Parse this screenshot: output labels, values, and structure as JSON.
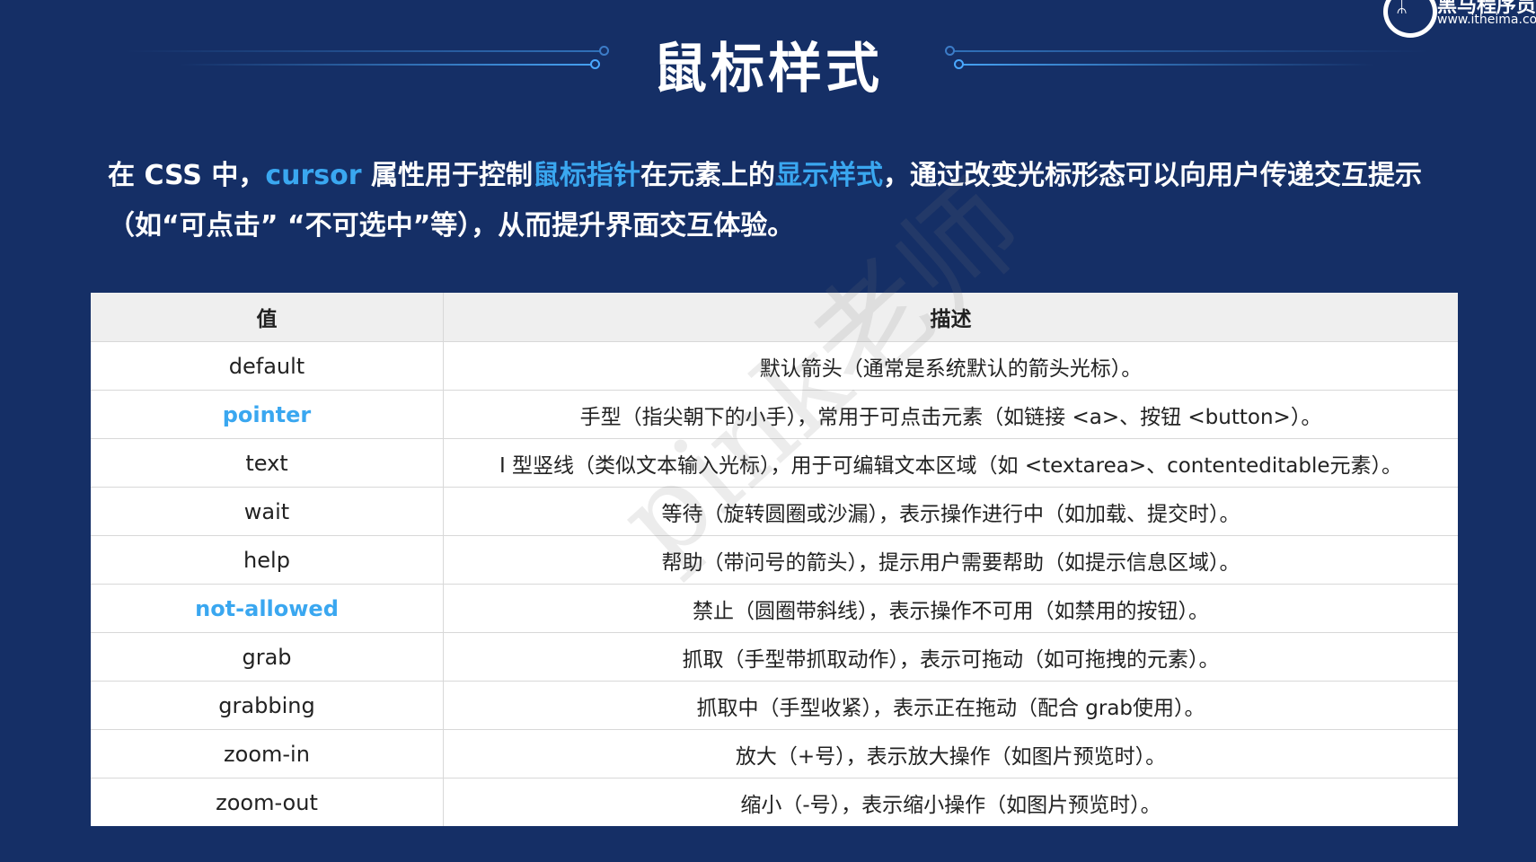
{
  "slide": {
    "title": "鼠标样式",
    "logo": {
      "name": "黑马程序员",
      "url": "www.itheima.com"
    },
    "intro": {
      "p1": "在 CSS 中，",
      "h1": "cursor",
      "p2": " 属性用于控制",
      "h2": "鼠标指针",
      "p3": "在元素上的",
      "h3": "显示样式",
      "p4": "，通过改变光标形态可以向用户传递交互提示（如“可点击” “不可选中”等），从而提升界面交互体验。"
    },
    "watermark": "pink老师",
    "colors": {
      "background": "#152f66",
      "highlight": "#3aa7f0",
      "table_header": "#efefef"
    }
  },
  "table": {
    "headers": [
      "值",
      "描述"
    ],
    "rows": [
      {
        "value": "default",
        "desc": "默认箭头（通常是系统默认的箭头光标）。"
      },
      {
        "value": "pointer",
        "desc": "手型（指尖朝下的小手），常用于可点击元素（如链接 <a>、按钮 <button>）。"
      },
      {
        "value": "text",
        "desc": "I 型竖线（类似文本输入光标），用于可编辑文本区域（如 <textarea>、contenteditable元素）。"
      },
      {
        "value": "wait",
        "desc": "等待（旋转圆圈或沙漏），表示操作进行中（如加载、提交时）。"
      },
      {
        "value": "help",
        "desc": "帮助（带问号的箭头），提示用户需要帮助（如提示信息区域）。"
      },
      {
        "value": "not-allowed",
        "desc": "禁止（圆圈带斜线），表示操作不可用（如禁用的按钮）。"
      },
      {
        "value": "grab",
        "desc": "抓取（手型带抓取动作），表示可拖动（如可拖拽的元素）。"
      },
      {
        "value": "grabbing",
        "desc": "抓取中（手型收紧），表示正在拖动（配合 grab使用）。"
      },
      {
        "value": "zoom-in",
        "desc": "放大（+号），表示放大操作（如图片预览时）。"
      },
      {
        "value": "zoom-out",
        "desc": "缩小（-号），表示缩小操作（如图片预览时）。"
      }
    ]
  }
}
